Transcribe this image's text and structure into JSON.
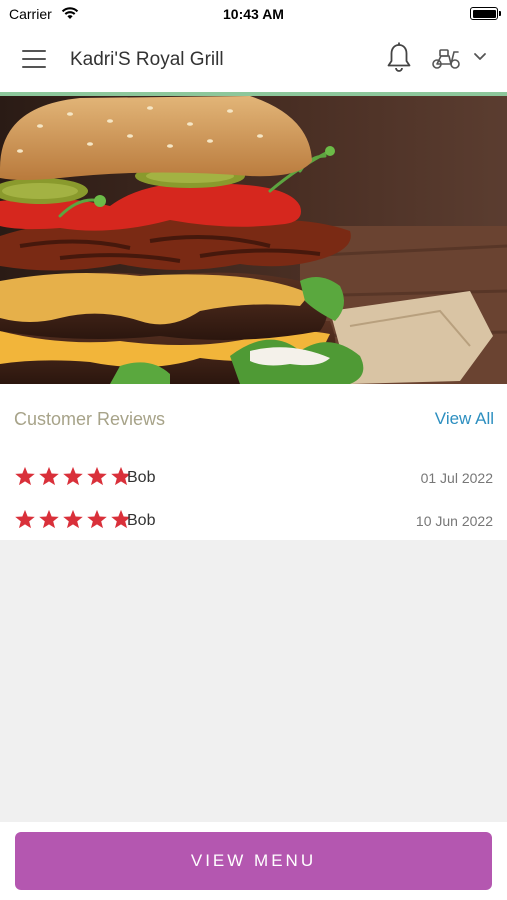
{
  "status_bar": {
    "carrier": "Carrier",
    "time": "10:43 AM"
  },
  "header": {
    "title": "Kadri'S Royal Grill"
  },
  "reviews": {
    "heading": "Customer Reviews",
    "view_all": "View All",
    "items": [
      {
        "rating": 5,
        "name": "Bob",
        "date": "01 Jul 2022"
      },
      {
        "rating": 5,
        "name": "Bob",
        "date": "10 Jun 2022"
      }
    ]
  },
  "footer": {
    "view_menu_label": "VIEW MENU"
  },
  "colors": {
    "accent": "#b457b0",
    "star": "#d9303a",
    "link": "#2d8fc0",
    "header_divider": "#8dc79b"
  },
  "icons": [
    "menu-icon",
    "bell-icon",
    "scooter-icon",
    "chevron-down-icon",
    "star-icon",
    "wifi-icon",
    "battery-icon"
  ]
}
